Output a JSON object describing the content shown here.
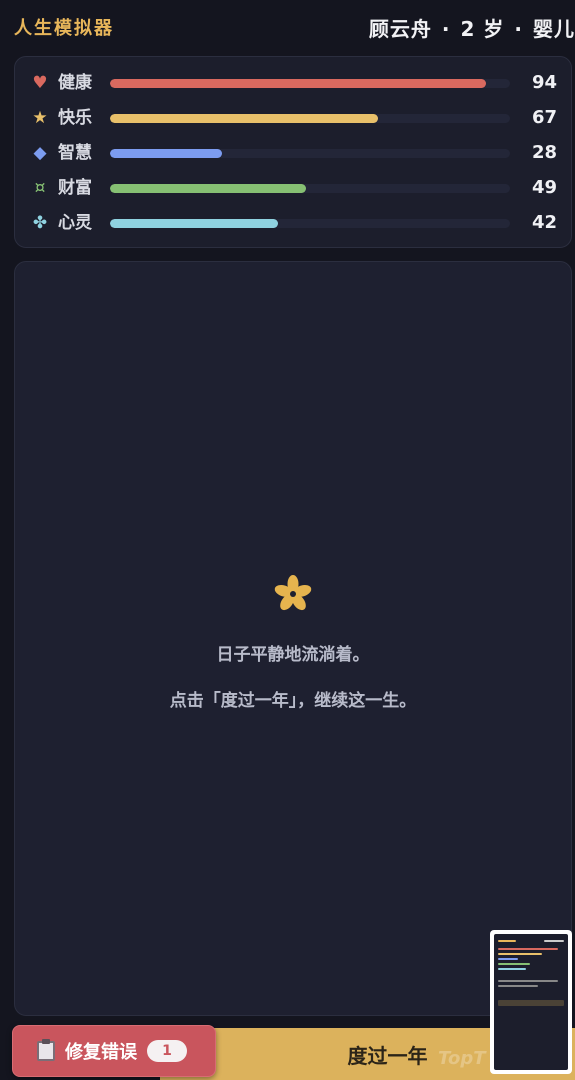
{
  "header": {
    "app_title": "人生模拟器",
    "char_name": "顾云舟",
    "char_age": "2 岁",
    "char_stage": "婴儿",
    "separator": "·"
  },
  "stats": [
    {
      "label": "健康",
      "value": 94,
      "icon": "heart-icon",
      "glyph": "♥",
      "color": "#d9695f",
      "icon_color": "#d9695f"
    },
    {
      "label": "快乐",
      "value": 67,
      "icon": "star-icon",
      "glyph": "★",
      "color": "#e8c06a",
      "icon_color": "#e8c06a"
    },
    {
      "label": "智慧",
      "value": 28,
      "icon": "diamond-icon",
      "glyph": "◆",
      "color": "#7c9cf0",
      "icon_color": "#7c9cf0"
    },
    {
      "label": "财富",
      "value": 49,
      "icon": "coin-icon",
      "glyph": "¤",
      "color": "#86c073",
      "icon_color": "#86c073"
    },
    {
      "label": "心灵",
      "value": 42,
      "icon": "spirit-icon",
      "glyph": "✤",
      "color": "#8fd2e0",
      "icon_color": "#8fd2e0"
    }
  ],
  "story": {
    "icon": "flower-icon",
    "line1": "日子平静地流淌着。",
    "line2": "点击「度过一年」，继续这一生。"
  },
  "actions": {
    "advance_label": "度过一年",
    "fix_label": "修复错误",
    "fix_count": "1"
  },
  "colors": {
    "accent": "#dcb25c",
    "danger": "#c9555d",
    "background": "#14151f"
  }
}
